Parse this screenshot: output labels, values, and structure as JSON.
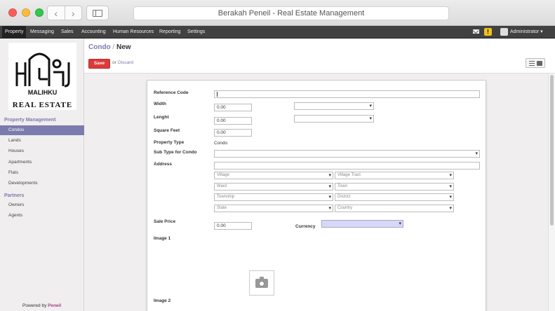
{
  "window": {
    "title": "Berakah Peneil - Real Estate Management"
  },
  "topmenu": {
    "items": [
      "Property",
      "Messaging",
      "Sales",
      "Accounting",
      "Human Resources",
      "Reporting",
      "Settings"
    ],
    "user": "Administrator ▾"
  },
  "logo": {
    "line1": "MALIHKU",
    "line2": "REAL ESTATE"
  },
  "sidebar": {
    "section1": "Property Management",
    "items1": [
      "Condos",
      "Lands",
      "Houses",
      "Apartments",
      "Flats",
      "Developments"
    ],
    "section2": "Partners",
    "items2": [
      "Owners",
      "Agents"
    ],
    "powered_prefix": "Powered by ",
    "powered_brand": "Peneil"
  },
  "header": {
    "breadcrumb_link": "Condo",
    "breadcrumb_sep": " / ",
    "breadcrumb_current": "New",
    "save_label": "Save",
    "or_label": "or",
    "discard_label": "Discard"
  },
  "form": {
    "labels": {
      "reference_code": "Reference Code",
      "width": "Width",
      "lenght": "Lenght",
      "square_feet": "Square Feet",
      "property_type": "Property Type",
      "sub_type": "Sub Type for Condo",
      "address": "Address",
      "sale_price": "Sale Price",
      "currency": "Currency",
      "image1": "Image 1",
      "image2": "Image 2"
    },
    "values": {
      "reference_code": "",
      "width": "0.00",
      "lenght": "0.00",
      "square_feet": "0.00",
      "property_type": "Condo",
      "sale_price": "0.00"
    },
    "address_placeholders": {
      "village": "Village",
      "village_tract": "Village Tract",
      "ward": "Ward",
      "town": "Town",
      "township": "Township",
      "district": "District",
      "state": "State",
      "country": "Country"
    }
  }
}
